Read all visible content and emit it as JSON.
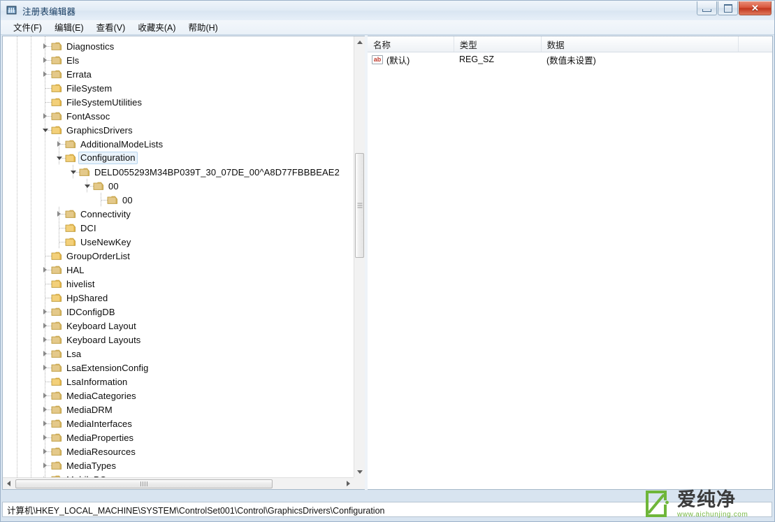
{
  "window": {
    "title": "注册表编辑器",
    "icon": "registry-editor-icon",
    "controls": {
      "minimize": "最小化",
      "maximize": "最大化",
      "close": "✕"
    }
  },
  "menubar": {
    "items": [
      {
        "label": "文件(F)",
        "name": "menu-file"
      },
      {
        "label": "编辑(E)",
        "name": "menu-edit"
      },
      {
        "label": "查看(V)",
        "name": "menu-view"
      },
      {
        "label": "收藏夹(A)",
        "name": "menu-favorites"
      },
      {
        "label": "帮助(H)",
        "name": "menu-help"
      }
    ]
  },
  "tree": {
    "selected_key": "Configuration",
    "nodes": [
      {
        "label": "Diagnostics",
        "depth": 3,
        "state": "collapsed"
      },
      {
        "label": "Els",
        "depth": 3,
        "state": "collapsed"
      },
      {
        "label": "Errata",
        "depth": 3,
        "state": "collapsed"
      },
      {
        "label": "FileSystem",
        "depth": 3,
        "state": "leaf"
      },
      {
        "label": "FileSystemUtilities",
        "depth": 3,
        "state": "leaf"
      },
      {
        "label": "FontAssoc",
        "depth": 3,
        "state": "collapsed"
      },
      {
        "label": "GraphicsDrivers",
        "depth": 3,
        "state": "expanded"
      },
      {
        "label": "AdditionalModeLists",
        "depth": 4,
        "state": "collapsed"
      },
      {
        "label": "Configuration",
        "depth": 4,
        "state": "expanded",
        "selected": true
      },
      {
        "label": "DELD055293M34BP039T_30_07DE_00^A8D77FBBBEAE2",
        "depth": 5,
        "state": "expanded"
      },
      {
        "label": "00",
        "depth": 6,
        "state": "expanded"
      },
      {
        "label": "00",
        "depth": 7,
        "state": "leaf"
      },
      {
        "label": "Connectivity",
        "depth": 4,
        "state": "collapsed"
      },
      {
        "label": "DCI",
        "depth": 4,
        "state": "leaf"
      },
      {
        "label": "UseNewKey",
        "depth": 4,
        "state": "leaf"
      },
      {
        "label": "GroupOrderList",
        "depth": 3,
        "state": "leaf"
      },
      {
        "label": "HAL",
        "depth": 3,
        "state": "collapsed"
      },
      {
        "label": "hivelist",
        "depth": 3,
        "state": "leaf"
      },
      {
        "label": "HpShared",
        "depth": 3,
        "state": "leaf"
      },
      {
        "label": "IDConfigDB",
        "depth": 3,
        "state": "collapsed"
      },
      {
        "label": "Keyboard Layout",
        "depth": 3,
        "state": "collapsed"
      },
      {
        "label": "Keyboard Layouts",
        "depth": 3,
        "state": "collapsed"
      },
      {
        "label": "Lsa",
        "depth": 3,
        "state": "collapsed"
      },
      {
        "label": "LsaExtensionConfig",
        "depth": 3,
        "state": "collapsed"
      },
      {
        "label": "LsaInformation",
        "depth": 3,
        "state": "leaf"
      },
      {
        "label": "MediaCategories",
        "depth": 3,
        "state": "collapsed"
      },
      {
        "label": "MediaDRM",
        "depth": 3,
        "state": "collapsed"
      },
      {
        "label": "MediaInterfaces",
        "depth": 3,
        "state": "collapsed"
      },
      {
        "label": "MediaProperties",
        "depth": 3,
        "state": "collapsed"
      },
      {
        "label": "MediaResources",
        "depth": 3,
        "state": "collapsed"
      },
      {
        "label": "MediaTypes",
        "depth": 3,
        "state": "collapsed"
      },
      {
        "label": "MobilePC",
        "depth": 3,
        "state": "collapsed"
      }
    ]
  },
  "values": {
    "columns": [
      {
        "label": "名称",
        "name": "column-name"
      },
      {
        "label": "类型",
        "name": "column-type"
      },
      {
        "label": "数据",
        "name": "column-data"
      }
    ],
    "rows": [
      {
        "icon": "string-value-icon",
        "name": "(默认)",
        "type": "REG_SZ",
        "data": "(数值未设置)"
      }
    ]
  },
  "statusbar": {
    "path": "计算机\\HKEY_LOCAL_MACHINE\\SYSTEM\\ControlSet001\\Control\\GraphicsDrivers\\Configuration"
  },
  "watermark": {
    "name": "爱纯净",
    "url": "www.aichunjing.com"
  },
  "colors": {
    "accent": "#77b843",
    "selection": "#eaf3fb",
    "folder": "#f5cf6b",
    "close_button": "#c0351c"
  }
}
